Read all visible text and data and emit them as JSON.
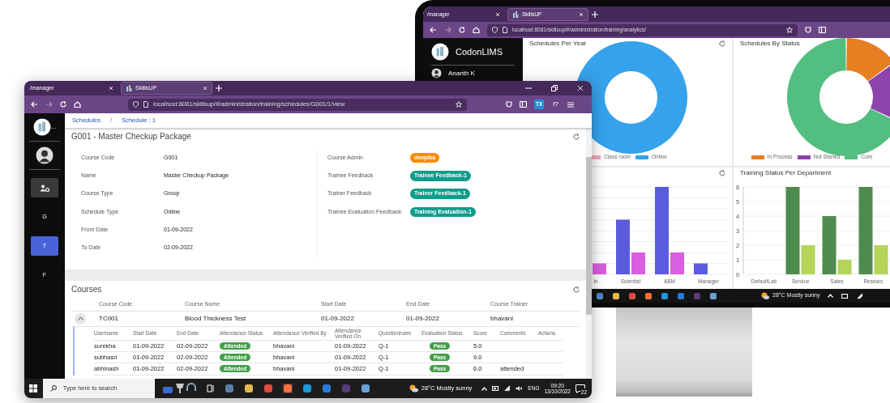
{
  "back_window": {
    "tabs": [
      {
        "label": "/manager",
        "selected": false
      },
      {
        "label": "SkillsUP",
        "selected": true
      }
    ],
    "address": "localhost:8081/skillsup/#/administration/training/analytics/",
    "sidebar": {
      "app_name": "CodonLIMS",
      "user": "Ananth K"
    },
    "panels": [
      {
        "title": "Schedules Per Year",
        "legend": [
          {
            "label": "Class room",
            "color": "#f4a7bb"
          },
          {
            "label": "Online",
            "color": "#36a2eb"
          }
        ]
      },
      {
        "title": "Schedules By Status",
        "legend": [
          {
            "label": "In Process",
            "color": "#e67e22"
          },
          {
            "label": "Not Started",
            "color": "#8e44ad"
          },
          {
            "label": "Com",
            "color": "#52be80"
          }
        ]
      },
      {
        "categories": [
          "in",
          "Scientist",
          "ABM",
          "Manager"
        ]
      },
      {
        "title": "Training Status Per Department",
        "chart_data": {
          "type": "bar",
          "categories": [
            "DefaultLab",
            "Service",
            "Sales",
            "Researc"
          ],
          "series": [
            {
              "color": "#4f8b4f",
              "values": [
                0,
                6,
                4,
                6
              ]
            },
            {
              "color": "#b4d45a",
              "values": [
                0,
                2,
                1,
                2
              ]
            }
          ],
          "ylim": [
            0,
            6
          ],
          "yticks": [
            0,
            1,
            2,
            3,
            4,
            5,
            6
          ],
          "grid": true
        }
      }
    ],
    "taskbar": {
      "weather": "28°C Mostly sunny"
    }
  },
  "front_window": {
    "tabs": [
      {
        "label": "/manager",
        "selected": false
      },
      {
        "label": "SkillsUP",
        "selected": true
      }
    ],
    "address": "localhost:8081/skillsup/#/administration/training/schedules/G001/1/view",
    "extensions": [
      "TX",
      "f?"
    ],
    "sidebar": {
      "app_name": "…",
      "items": [
        {
          "kind": "icon",
          "selected": false
        },
        {
          "kind": "letter",
          "label": "G",
          "selected": false
        },
        {
          "kind": "letter",
          "label": "T",
          "selected": true
        },
        {
          "kind": "letter",
          "label": "F",
          "selected": false
        }
      ]
    },
    "breadcrumb": {
      "items": [
        "Schedules",
        "Schedule : 1"
      ],
      "separator": "/"
    },
    "title": "G001 - Master Checkup Package",
    "details_left": [
      {
        "label": "Course Code",
        "value": "G001"
      },
      {
        "label": "Name",
        "value": "Master Checkup Package"
      },
      {
        "label": "Course Type",
        "value": "Group"
      },
      {
        "label": "Schedule Type",
        "value": "Online"
      },
      {
        "label": "From Date",
        "value": "01-09-2022"
      },
      {
        "label": "To Date",
        "value": "02-09-2022"
      }
    ],
    "details_right": [
      {
        "label": "Course Admin",
        "value": "deepika",
        "color": "#ff8a00"
      },
      {
        "label": "Trainee Feedback",
        "value": "Trainee Feedback-1",
        "color": "#119c8c"
      },
      {
        "label": "Trainer Feedback",
        "value": "Trainer Feedback-1",
        "color": "#119c8c"
      },
      {
        "label": "Trainee Evaluation Feedback:",
        "value": "Training Evaluation-1",
        "color": "#119c8c"
      }
    ],
    "courses": {
      "title": "Courses",
      "columns": [
        "Course Code",
        "Course Name",
        "Start Date",
        "End Date",
        "Course Trainer"
      ],
      "rows": [
        {
          "expanded": true,
          "cells": [
            "TC001",
            "Blood Thickness Test",
            "01-09-2022",
            "01-09-2022",
            "bhavani"
          ]
        }
      ],
      "sub_table": {
        "columns": [
          "Username",
          "Start Date",
          "End Date",
          "Attendance Status",
          "Attendance Verified By",
          "Attendance Verified On",
          "Questionnaire",
          "Evaluation Status",
          "Score",
          "Comments",
          "Actions"
        ],
        "rows": [
          {
            "username": "surekha",
            "start": "01-09-2022",
            "end": "02-09-2022",
            "attendance": "Attended",
            "verified_by": "bhavani",
            "verified_on": "01-09-2022",
            "questionnaire": "Q-1",
            "evaluation": "Pass",
            "score": "5.0"
          },
          {
            "username": "subhasri",
            "start": "01-09-2022",
            "end": "02-09-2022",
            "attendance": "Attended",
            "verified_by": "bhavani",
            "verified_on": "01-09-2022",
            "questionnaire": "Q-1",
            "evaluation": "Pass",
            "score": "9.0"
          },
          {
            "username": "abhinash",
            "start": "01-09-2022",
            "end": "02-09-2022",
            "attendance": "Attended",
            "verified_by": "bhavani",
            "verified_on": "01-09-2022",
            "questionnaire": "Q-1",
            "evaluation": "Pass",
            "score": "6.0",
            "comments": "attended"
          }
        ]
      }
    },
    "taskbar": {
      "search_placeholder": "Type here to search",
      "weather": "28°C Mostly sunny",
      "language": "ENG",
      "time": "09:20",
      "date": "13/10/2022",
      "notifications": "22"
    }
  }
}
